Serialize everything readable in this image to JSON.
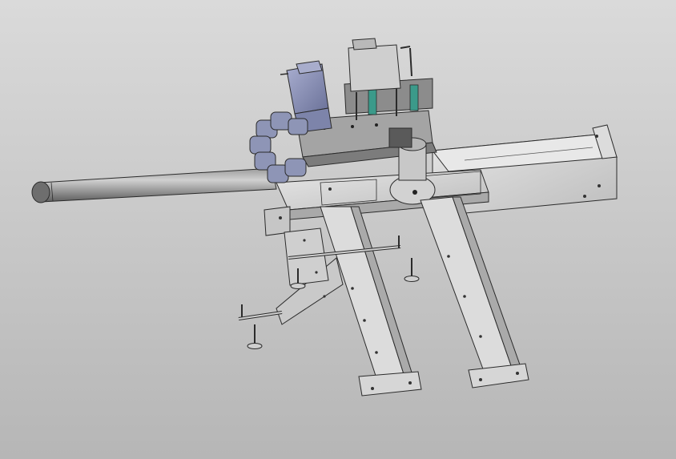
{
  "viewport": {
    "background_top": "#dadada",
    "background_bottom": "#b6b6b6"
  },
  "model": {
    "parts": [
      "rail-beam",
      "main-plate",
      "left-leg",
      "right-leg",
      "pipe-arm",
      "servo-motor-left",
      "servo-motor-top",
      "cable-chain",
      "pulley-disc",
      "slide-carriage",
      "lower-bracket",
      "leveling-feet"
    ],
    "colors": {
      "metal": "#d4d4d4",
      "metal_dark": "#9a9a9a",
      "edge": "#2b2b2b",
      "motor": "#8e95b6",
      "motor_dark": "#5e6485",
      "pipe": "#7d7d7d",
      "green": "#3b9a8a"
    }
  }
}
